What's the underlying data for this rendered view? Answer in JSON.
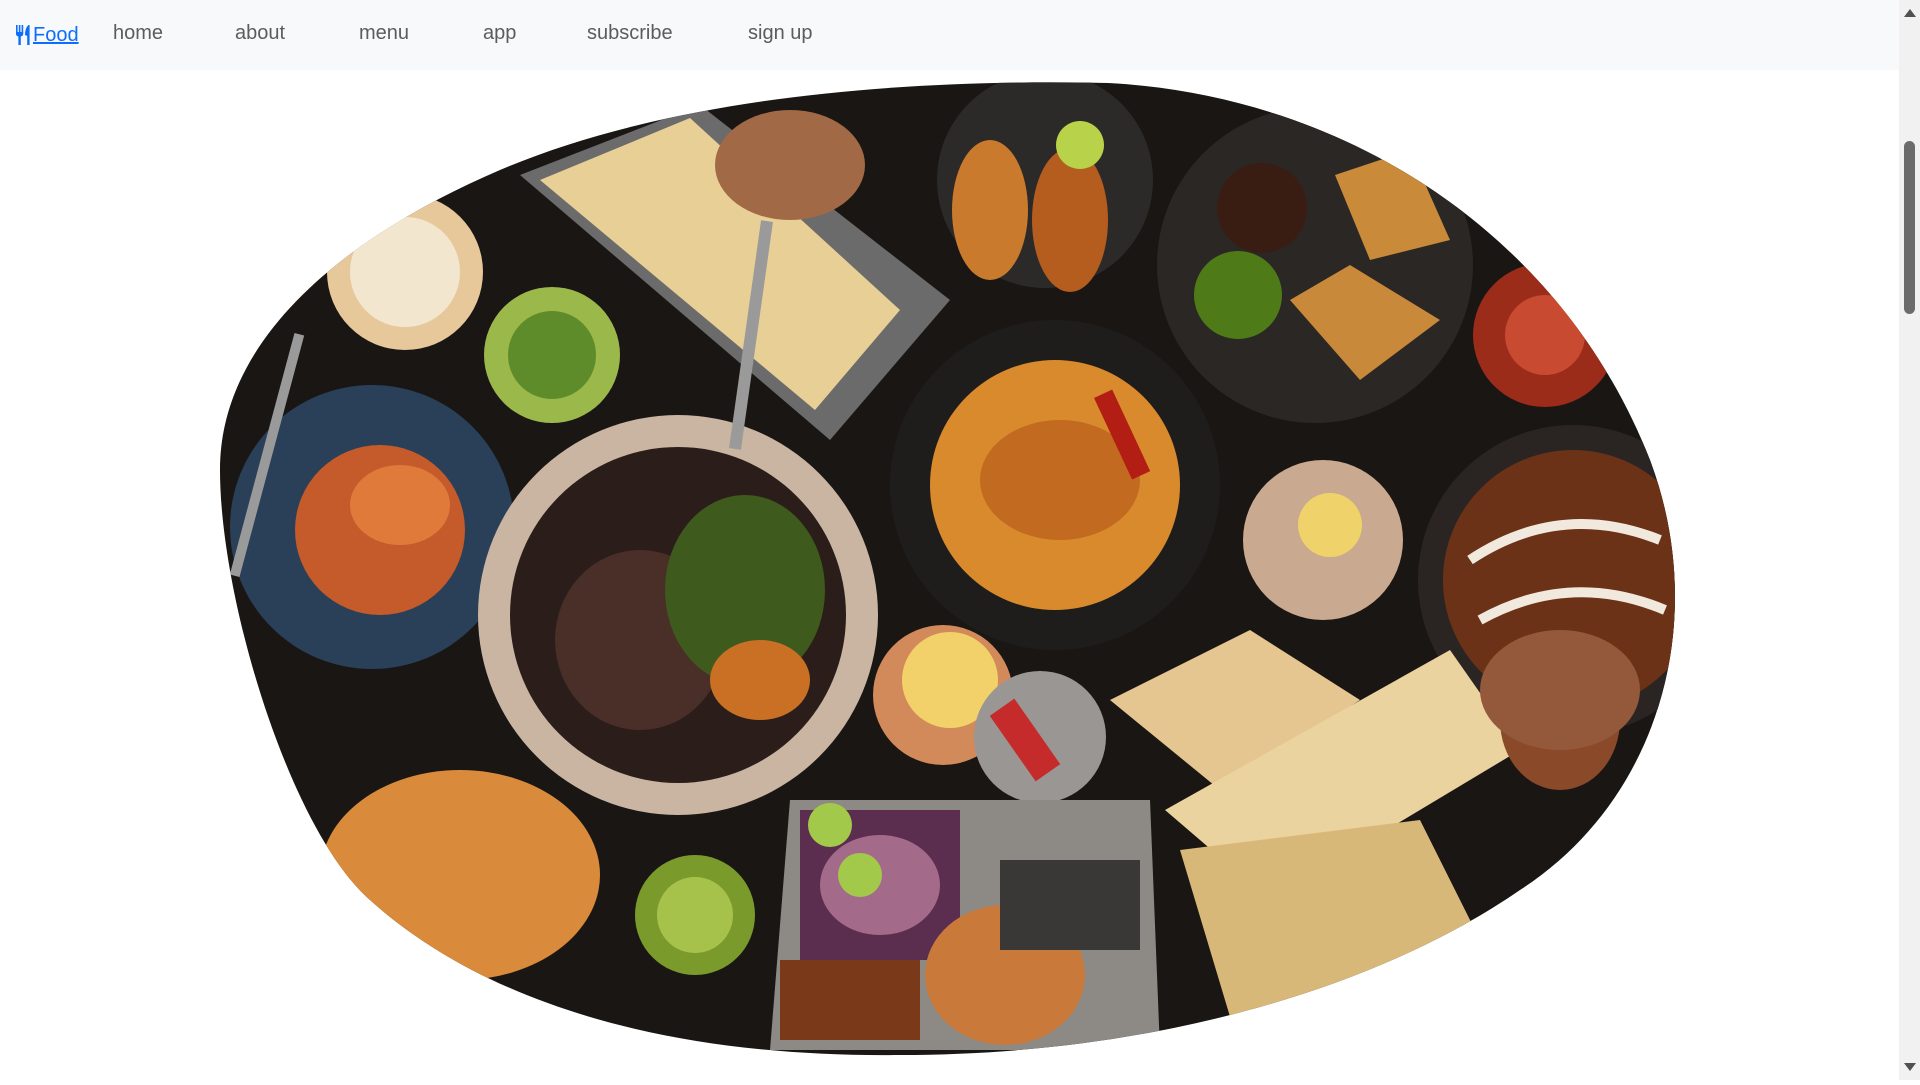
{
  "navbar": {
    "brand": {
      "icon": "utensils-icon",
      "label": "Food",
      "color": "#0d6efd"
    },
    "links": [
      "home",
      "about",
      "menu",
      "app",
      "subscribe",
      "sign up"
    ]
  },
  "hero": {
    "image": {
      "subject": "overhead-table-of-indian-dishes-in-blob-frame"
    }
  },
  "colors": {
    "navbar_bg": "#f8f9fa",
    "link": "#0d6efd",
    "nav_text": "#5c5c5c",
    "table_bg": "#1a1614"
  }
}
